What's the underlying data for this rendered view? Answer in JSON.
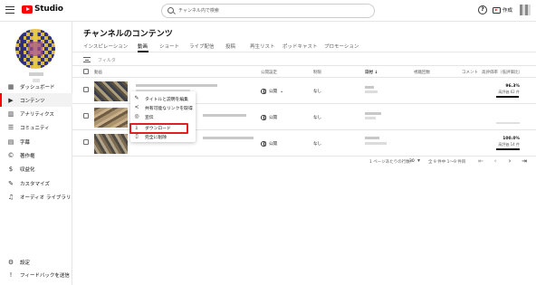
{
  "app": {
    "logo_text": "Studio",
    "brand_color": "#ff0000"
  },
  "search": {
    "placeholder": "チャンネル内で検索"
  },
  "header": {
    "create_label": "作成",
    "help_icon": "help-icon"
  },
  "sidebar": {
    "items": [
      {
        "label": "ダッシュボード",
        "icon": "dashboard-icon",
        "glyph": "▦"
      },
      {
        "label": "コンテンツ",
        "icon": "content-icon",
        "glyph": "▶"
      },
      {
        "label": "アナリティクス",
        "icon": "analytics-icon",
        "glyph": "▥"
      },
      {
        "label": "コミュニティ",
        "icon": "community-icon",
        "glyph": "☰"
      },
      {
        "label": "字幕",
        "icon": "subtitles-icon",
        "glyph": "▤"
      },
      {
        "label": "著作権",
        "icon": "copyright-icon",
        "glyph": "©"
      },
      {
        "label": "収益化",
        "icon": "monetization-icon",
        "glyph": "$"
      },
      {
        "label": "カスタマイズ",
        "icon": "customize-icon",
        "glyph": "✎"
      },
      {
        "label": "オーディオ ライブラリ",
        "icon": "audio-library-icon",
        "glyph": "♫"
      }
    ],
    "bottom": [
      {
        "label": "設定",
        "icon": "settings-icon",
        "glyph": "⚙"
      },
      {
        "label": "フィードバックを送信",
        "icon": "feedback-icon",
        "glyph": "!"
      }
    ]
  },
  "main": {
    "title": "チャンネルのコンテンツ",
    "tabs": [
      "インスピレーション",
      "動画",
      "ショート",
      "ライブ配信",
      "投稿",
      "再生リスト",
      "ポッドキャスト",
      "プロモーション"
    ],
    "active_tab": 1,
    "filter_label": "フィルタ",
    "columns": [
      "動画",
      "公開設定",
      "制限",
      "日付 ↓",
      "視聴回数",
      "コメント",
      "高評価率（低評価比）"
    ],
    "rows": [
      {
        "visibility": "公開",
        "restriction": "なし",
        "like_pct": "96.3%",
        "like_sub": "高評価 62 件",
        "like_fraction": 0.963
      },
      {
        "visibility": "公開",
        "restriction": "なし",
        "like_pct": "",
        "like_sub": "",
        "like_fraction": 0
      },
      {
        "visibility": "公開",
        "restriction": "なし",
        "like_pct": "100.0%",
        "like_sub": "高評価 14 件",
        "like_fraction": 1.0
      }
    ],
    "pager": {
      "rows_label": "1 ページあたりの行数:",
      "rows_value": "30",
      "range": "全 9 件中 1～9 件目"
    }
  },
  "context_menu": {
    "items": [
      {
        "label": "タイトルと説明を編集",
        "icon": "edit-icon",
        "glyph": "✎"
      },
      {
        "label": "共有可能なリンクを取得",
        "icon": "share-icon",
        "glyph": "<"
      },
      {
        "label": "宣伝",
        "icon": "promote-icon",
        "glyph": "◎"
      },
      {
        "label": "ダウンロード",
        "icon": "download-icon",
        "glyph": "⤓"
      },
      {
        "label": "完全に削除",
        "icon": "delete-icon",
        "glyph": "▯"
      }
    ]
  }
}
